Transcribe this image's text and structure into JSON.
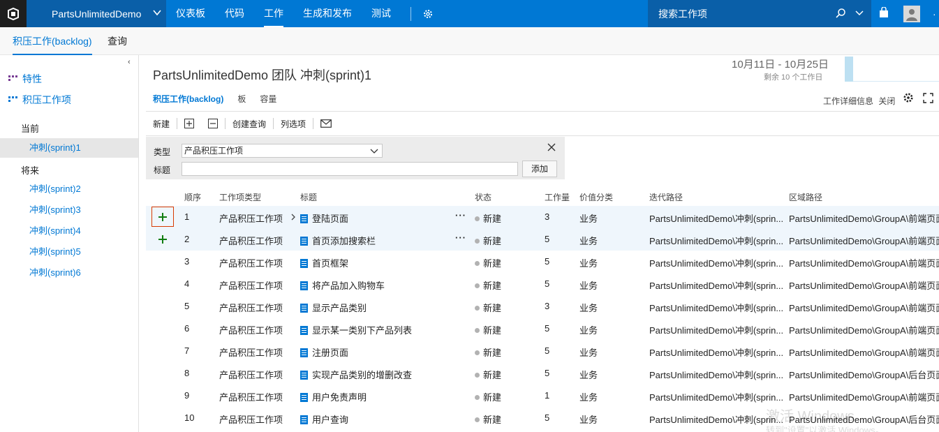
{
  "topbar": {
    "project": "PartsUnlimitedDemo",
    "nav": [
      "仪表板",
      "代码",
      "工作",
      "生成和发布",
      "测试"
    ],
    "active_nav": "工作",
    "search_placeholder": "搜索工作项",
    "accent": "#0078d4"
  },
  "subbar": {
    "tabs": [
      "积压工作(backlog)",
      "查询"
    ]
  },
  "left": {
    "links": [
      "特性",
      "积压工作项"
    ],
    "current_heading": "当前",
    "current_sprint": "冲刺(sprint)1",
    "future_heading": "将来",
    "future_sprints": [
      "冲刺(sprint)2",
      "冲刺(sprint)3",
      "冲刺(sprint)4",
      "冲刺(sprint)5",
      "冲刺(sprint)6"
    ]
  },
  "main": {
    "title": "PartsUnlimitedDemo 团队 冲刺(sprint)1",
    "date_range": "10月11日 - 10月25日",
    "days_left": "剩余 10 个工作日",
    "pivots": [
      "积压工作(backlog)",
      "板",
      "容量"
    ],
    "details": "工作详细信息",
    "details_state": "关闭",
    "toolbar": {
      "new": "新建",
      "create_query": "创建查询",
      "column_options": "列选项"
    },
    "add_panel": {
      "type_label": "类型",
      "type_value": "产品积压工作项",
      "title_label": "标题",
      "title_value": "",
      "add_button": "添加"
    }
  },
  "grid": {
    "columns": [
      "顺序",
      "工作项类型",
      "标题",
      "状态",
      "工作量",
      "价值分类",
      "迭代路径",
      "区域路径"
    ],
    "rows": [
      {
        "order": "1",
        "type": "产品积压工作项",
        "title": "登陆页面",
        "state": "新建",
        "effort": "3",
        "value": "业务",
        "iteration": "PartsUnlimitedDemo\\冲刺(sprin...",
        "area": "PartsUnlimitedDemo\\GroupA\\前端页面"
      },
      {
        "order": "2",
        "type": "产品积压工作项",
        "title": "首页添加搜索栏",
        "state": "新建",
        "effort": "5",
        "value": "业务",
        "iteration": "PartsUnlimitedDemo\\冲刺(sprin...",
        "area": "PartsUnlimitedDemo\\GroupA\\前端页面"
      },
      {
        "order": "3",
        "type": "产品积压工作项",
        "title": "首页框架",
        "state": "新建",
        "effort": "5",
        "value": "业务",
        "iteration": "PartsUnlimitedDemo\\冲刺(sprin...",
        "area": "PartsUnlimitedDemo\\GroupA\\前端页面"
      },
      {
        "order": "4",
        "type": "产品积压工作项",
        "title": "将产品加入购物车",
        "state": "新建",
        "effort": "5",
        "value": "业务",
        "iteration": "PartsUnlimitedDemo\\冲刺(sprin...",
        "area": "PartsUnlimitedDemo\\GroupA\\前端页面"
      },
      {
        "order": "5",
        "type": "产品积压工作项",
        "title": "显示产品类别",
        "state": "新建",
        "effort": "3",
        "value": "业务",
        "iteration": "PartsUnlimitedDemo\\冲刺(sprin...",
        "area": "PartsUnlimitedDemo\\GroupA\\前端页面"
      },
      {
        "order": "6",
        "type": "产品积压工作项",
        "title": "显示某一类别下产品列表",
        "state": "新建",
        "effort": "5",
        "value": "业务",
        "iteration": "PartsUnlimitedDemo\\冲刺(sprin...",
        "area": "PartsUnlimitedDemo\\GroupA\\前端页面"
      },
      {
        "order": "7",
        "type": "产品积压工作项",
        "title": "注册页面",
        "state": "新建",
        "effort": "5",
        "value": "业务",
        "iteration": "PartsUnlimitedDemo\\冲刺(sprin...",
        "area": "PartsUnlimitedDemo\\GroupA\\前端页面"
      },
      {
        "order": "8",
        "type": "产品积压工作项",
        "title": "实现产品类别的增删改查",
        "state": "新建",
        "effort": "5",
        "value": "业务",
        "iteration": "PartsUnlimitedDemo\\冲刺(sprin...",
        "area": "PartsUnlimitedDemo\\GroupA\\后台页面"
      },
      {
        "order": "9",
        "type": "产品积压工作项",
        "title": "用户免责声明",
        "state": "新建",
        "effort": "1",
        "value": "业务",
        "iteration": "PartsUnlimitedDemo\\冲刺(sprin...",
        "area": "PartsUnlimitedDemo\\GroupA\\前端页面"
      },
      {
        "order": "10",
        "type": "产品积压工作项",
        "title": "用户查询",
        "state": "新建",
        "effort": "5",
        "value": "业务",
        "iteration": "PartsUnlimitedDemo\\冲刺(sprin...",
        "area": "PartsUnlimitedDemo\\GroupA\\后台页面"
      }
    ]
  },
  "watermark": {
    "line1": "激活 Windows",
    "line2": "转到\"设置\"以激活 Windows。"
  }
}
